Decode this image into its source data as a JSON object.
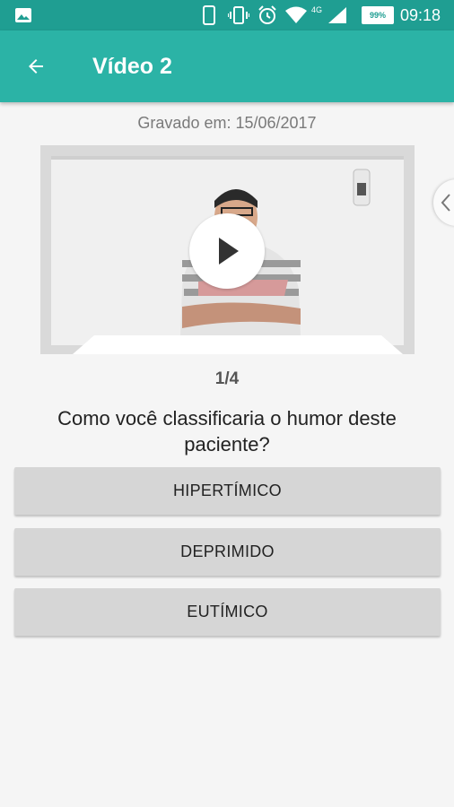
{
  "status_bar": {
    "time": "09:18",
    "battery": "99%",
    "network": "4G",
    "icons": [
      "image-icon",
      "phone-icon",
      "vibrate-icon",
      "alarm-icon",
      "wifi-icon",
      "signal-icon",
      "battery-icon"
    ]
  },
  "app_bar": {
    "title": "Vídeo 2",
    "back_icon": "arrow-left-icon"
  },
  "recorded": "Gravado em: 15/06/2017",
  "video": {
    "play_icon": "play-icon"
  },
  "drawer_handle_icon": "chevron-left-icon",
  "counter": "1/4",
  "question": "Como você classificaria o humor deste paciente?",
  "answers": [
    {
      "label": "HIPERTÍMICO"
    },
    {
      "label": "DEPRIMIDO"
    },
    {
      "label": "EUTÍMICO"
    }
  ],
  "colors": {
    "app_bar": "#2bb3a6",
    "status_bar": "#1f9e92",
    "button": "#d6d6d6"
  }
}
